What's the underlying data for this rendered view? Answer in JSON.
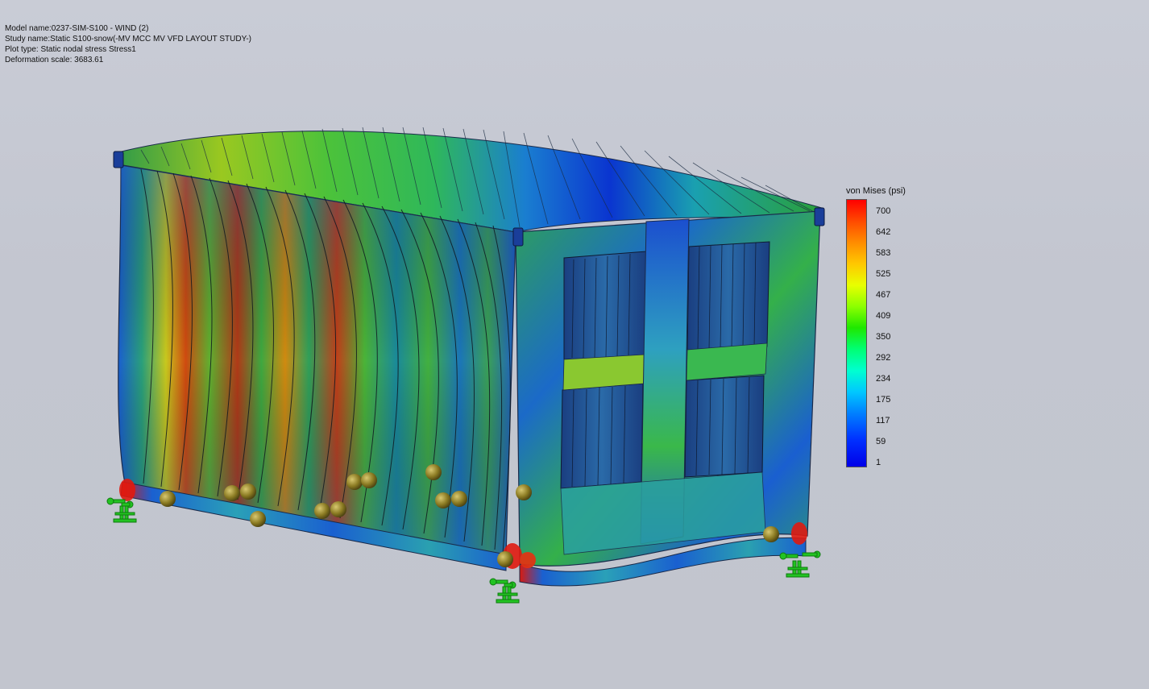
{
  "header": {
    "model_name": "Model name:0237-SIM-S100 - WIND (2)",
    "study_name": "Study name:Static S100-snow(-MV MCC MV VFD LAYOUT STUDY-)",
    "plot_type": "Plot type: Static nodal stress Stress1",
    "deformation_scale": "Deformation scale: 3683.61"
  },
  "legend": {
    "title": "von Mises (psi)",
    "values": [
      "700",
      "642",
      "583",
      "525",
      "467",
      "409",
      "350",
      "292",
      "234",
      "175",
      "117",
      "59",
      "1"
    ]
  },
  "colors": {
    "background": "#c5c8d1",
    "fixture_green": "#22c322",
    "load_sphere": "#8a7a22",
    "high_stress": "#ff0000",
    "low_stress": "#0000e8"
  },
  "icons": {
    "fixture": "fixed-geometry-icon",
    "load": "external-load-sphere-icon"
  }
}
